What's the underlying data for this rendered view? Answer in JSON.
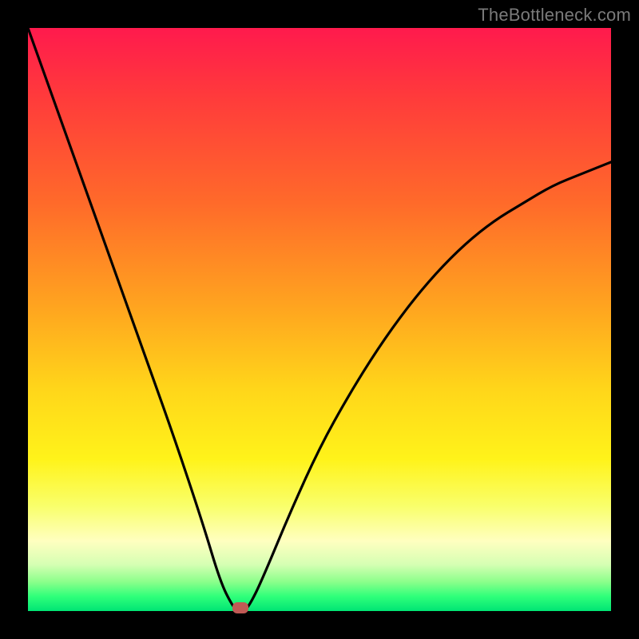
{
  "watermark": "TheBottleneck.com",
  "chart_data": {
    "type": "line",
    "title": "",
    "xlabel": "",
    "ylabel": "",
    "xlim": [
      0,
      100
    ],
    "ylim": [
      0,
      100
    ],
    "grid": false,
    "legend": false,
    "series": [
      {
        "name": "curve",
        "x": [
          0,
          5,
          10,
          15,
          20,
          25,
          30,
          33,
          35,
          36,
          37,
          38,
          40,
          45,
          50,
          55,
          60,
          65,
          70,
          75,
          80,
          85,
          90,
          95,
          100
        ],
        "y": [
          100,
          86,
          72,
          58,
          44,
          30,
          15,
          5,
          1,
          0,
          0,
          1,
          5,
          17,
          28,
          37,
          45,
          52,
          58,
          63,
          67,
          70,
          73,
          75,
          77
        ]
      }
    ],
    "marker": {
      "x": 36.5,
      "y": 0.5
    },
    "background_gradient": {
      "top": "#ff1a4d",
      "bottom": "#00e574"
    }
  }
}
